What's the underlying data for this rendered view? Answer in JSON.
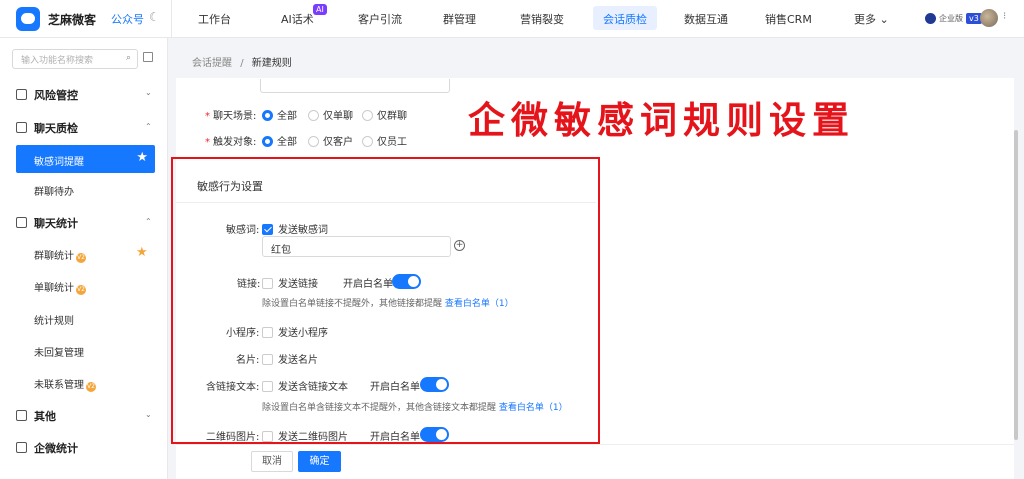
{
  "topbar": {
    "brand": "芝麻微客",
    "account": "公众号",
    "nav": [
      "工作台",
      "AI话术",
      "客户引流",
      "群管理",
      "营销裂变",
      "会话质检",
      "数据互通",
      "销售CRM",
      "更多"
    ],
    "ai_badge": "AI",
    "active_nav": "会话质检",
    "enterprise": "企业版",
    "version": "v3"
  },
  "sidebar": {
    "search_placeholder": "输入功能名称搜索",
    "groups": [
      {
        "label": "风险管控",
        "caret": "⌄"
      },
      {
        "label": "聊天质检",
        "caret": "⌃"
      },
      {
        "label": "聊天统计",
        "caret": "⌃"
      },
      {
        "label": "其他",
        "caret": "⌄"
      },
      {
        "label": "企微统计"
      }
    ],
    "items": [
      "敏感词提醒",
      "群聊待办",
      "群聊统计",
      "单聊统计",
      "统计规则",
      "未回复管理",
      "未联系管理"
    ],
    "v2": "V2"
  },
  "breadcrumb": {
    "parent": "会话提醒",
    "sep": "/",
    "current": "新建规则"
  },
  "form": {
    "chat_scene": {
      "label": "聊天场景:",
      "options": [
        "全部",
        "仅单聊",
        "仅群聊"
      ],
      "selected": "全部"
    },
    "trigger": {
      "label": "触发对象:",
      "options": [
        "全部",
        "仅客户",
        "仅员工"
      ],
      "selected": "全部"
    }
  },
  "watermark": "企微敏感词规则设置",
  "section": {
    "title": "敏感行为设置",
    "sensitive": {
      "label": "敏感词:",
      "checkbox": "发送敏感词",
      "checked": true,
      "word": "红包"
    },
    "link": {
      "label": "链接:",
      "checkbox": "发送链接",
      "whitelist": "开启白名单",
      "hint": "除设置白名单链接不提醒外，其他链接都提醒",
      "view": "查看白名单（1）"
    },
    "miniapp": {
      "label": "小程序:",
      "checkbox": "发送小程序"
    },
    "card": {
      "label": "名片:",
      "checkbox": "发送名片"
    },
    "linktext": {
      "label": "含链接文本:",
      "checkbox": "发送含链接文本",
      "whitelist": "开启白名单",
      "hint": "除设置白名单含链接文本不提醒外，其他含链接文本都提醒",
      "view": "查看白名单（1）"
    },
    "qrcode": {
      "label": "二维码图片:",
      "checkbox": "发送二维码图片",
      "whitelist": "开启白名单"
    }
  },
  "buttons": {
    "cancel": "取消",
    "ok": "确定"
  }
}
